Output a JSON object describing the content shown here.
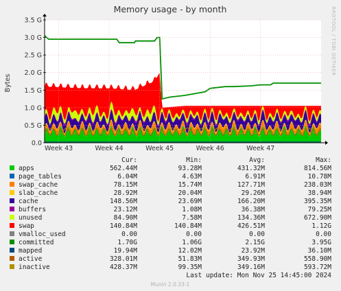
{
  "chart_data": {
    "type": "area",
    "title": "Memory usage - by month",
    "ylabel": "Bytes",
    "side_label": "RRDTOOL / TOBI OETIKER",
    "ylim": [
      0,
      3.5
    ],
    "y_unit": "G",
    "yticks": [
      "0.0",
      "0.5 G",
      "1.0 G",
      "1.5 G",
      "2.0 G",
      "2.5 G",
      "3.0 G",
      "3.5 G"
    ],
    "yticks_values": [
      0,
      0.5,
      1.0,
      1.5,
      2.0,
      2.5,
      3.0,
      3.5
    ],
    "x_ticks": [
      "Week 43",
      "Week 44",
      "Week 45",
      "Week 46",
      "Week 47"
    ],
    "x_ticks_pos": [
      43,
      44,
      45,
      46,
      47
    ],
    "xlim": [
      42.72,
      48.2
    ],
    "grid": true,
    "legend_headers": [
      "Cur:",
      "Min:",
      "Avg:",
      "Max:"
    ],
    "series": [
      {
        "name": "apps",
        "color": "#00cc00",
        "cur": "562.44M",
        "min": "93.28M",
        "avg": "431.32M",
        "max": "814.56M"
      },
      {
        "name": "page_tables",
        "color": "#0066b3",
        "cur": "6.04M",
        "min": "4.63M",
        "avg": "6.91M",
        "max": "10.78M"
      },
      {
        "name": "swap_cache",
        "color": "#ff8000",
        "cur": "78.15M",
        "min": "15.74M",
        "avg": "127.71M",
        "max": "238.03M"
      },
      {
        "name": "slab_cache",
        "color": "#ffcc00",
        "cur": "28.92M",
        "min": "20.04M",
        "avg": "29.26M",
        "max": "38.94M"
      },
      {
        "name": "cache",
        "color": "#330099",
        "cur": "148.56M",
        "min": "23.69M",
        "avg": "166.20M",
        "max": "395.35M"
      },
      {
        "name": "buffers",
        "color": "#990099",
        "cur": "23.12M",
        "min": "1.08M",
        "avg": "36.38M",
        "max": "79.25M"
      },
      {
        "name": "unused",
        "color": "#ccff00",
        "cur": "84.90M",
        "min": "7.58M",
        "avg": "134.36M",
        "max": "672.90M"
      },
      {
        "name": "swap",
        "color": "#ff0000",
        "cur": "140.84M",
        "min": "140.84M",
        "avg": "426.51M",
        "max": "1.12G"
      },
      {
        "name": "vmalloc_used",
        "color": "#808080",
        "cur": "0.00",
        "min": "0.00",
        "avg": "0.00",
        "max": "0.00"
      },
      {
        "name": "committed",
        "color": "#008f00",
        "cur": "1.70G",
        "min": "1.06G",
        "avg": "2.15G",
        "max": "3.95G"
      },
      {
        "name": "mapped",
        "color": "#00487d",
        "cur": "19.94M",
        "min": "12.02M",
        "avg": "23.92M",
        "max": "36.10M"
      },
      {
        "name": "active",
        "color": "#b35a00",
        "cur": "328.01M",
        "min": "51.83M",
        "avg": "349.93M",
        "max": "558.90M"
      },
      {
        "name": "inactive",
        "color": "#b38f00",
        "cur": "428.37M",
        "min": "99.35M",
        "avg": "349.16M",
        "max": "593.72M"
      }
    ],
    "committed_line": {
      "x": [
        42.72,
        42.8,
        44.15,
        44.2,
        44.5,
        44.52,
        44.9,
        44.95,
        45.0,
        45.05,
        45.2,
        45.5,
        45.7,
        45.9,
        46.0,
        46.3,
        46.45,
        46.8,
        47.0,
        47.1,
        47.2,
        47.25,
        48.2
      ],
      "y": [
        3.05,
        2.95,
        2.95,
        2.85,
        2.85,
        2.9,
        2.9,
        3.0,
        3.0,
        1.25,
        1.3,
        1.35,
        1.4,
        1.45,
        1.55,
        1.6,
        1.6,
        1.62,
        1.65,
        1.65,
        1.65,
        1.7,
        1.7
      ]
    },
    "swap_top": {
      "x": [
        42.72,
        43.5,
        44.0,
        44.5,
        44.9,
        45.0,
        45.05,
        45.5,
        46.0,
        46.5,
        47.0,
        47.4,
        48.2
      ],
      "y": [
        1.6,
        1.55,
        1.55,
        1.5,
        1.75,
        2.0,
        1.0,
        1.05,
        1.05,
        1.05,
        1.05,
        1.05,
        1.05
      ]
    },
    "footer": {
      "last_update": "Last update:  Mon Nov 25 14:45:00 2024",
      "munin": "Munin 2.0.33-1"
    }
  }
}
